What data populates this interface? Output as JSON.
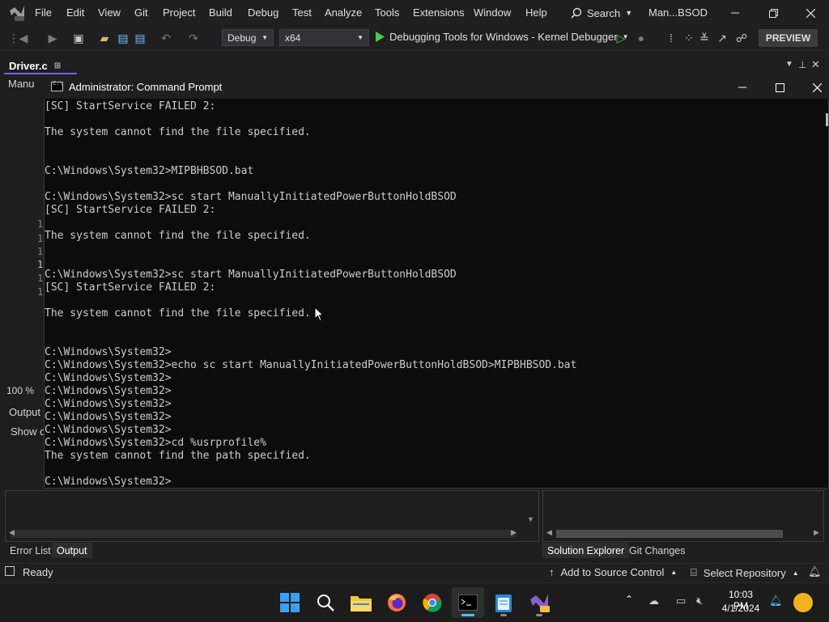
{
  "vs": {
    "menu": [
      "File",
      "Edit",
      "View",
      "Git",
      "Project",
      "Build",
      "Debug",
      "Test",
      "Analyze",
      "Tools",
      "Extensions",
      "Window",
      "Help"
    ],
    "search_label": "Search",
    "solution_name": "Man...BSOD",
    "config": "Debug",
    "platform": "x64",
    "debugger": "Debugging Tools for Windows - Kernel Debugger",
    "preview": "PREVIEW",
    "doc_tab": "Driver.c",
    "nav_label": "Manu",
    "line_numbers": [
      "1",
      "1",
      "1",
      "1",
      "1",
      "1"
    ],
    "zoom": "100 %",
    "output_title": "Output",
    "show_output_from": "Show o",
    "bottom_tabs_left": [
      "Error List",
      "Output"
    ],
    "bottom_tabs_right": [
      "Solution Explorer",
      "Git Changes"
    ],
    "status_ready": "Ready",
    "add_to_source_control": "Add to Source Control",
    "select_repository": "Select Repository",
    "accent_color": "#7160e8"
  },
  "cmd": {
    "title": "Administrator: Command Prompt",
    "lines": [
      "[SC] StartService FAILED 2:",
      "",
      "The system cannot find the file specified.",
      "",
      "",
      "C:\\Windows\\System32>MIPBHBSOD.bat",
      "",
      "C:\\Windows\\System32>sc start ManuallyInitiatedPowerButtonHoldBSOD",
      "[SC] StartService FAILED 2:",
      "",
      "The system cannot find the file specified.",
      "",
      "",
      "C:\\Windows\\System32>sc start ManuallyInitiatedPowerButtonHoldBSOD",
      "[SC] StartService FAILED 2:",
      "",
      "The system cannot find the file specified.",
      "",
      "",
      "C:\\Windows\\System32>",
      "C:\\Windows\\System32>echo sc start ManuallyInitiatedPowerButtonHoldBSOD>MIPBHBSOD.bat",
      "C:\\Windows\\System32>",
      "C:\\Windows\\System32>",
      "C:\\Windows\\System32>",
      "C:\\Windows\\System32>",
      "C:\\Windows\\System32>",
      "C:\\Windows\\System32>cd %usrprofile%",
      "The system cannot find the path specified.",
      "",
      "C:\\Windows\\System32>"
    ]
  },
  "taskbar": {
    "apps": [
      "start-button",
      "search-button",
      "file-explorer",
      "firefox",
      "chrome",
      "command-prompt",
      "notepad",
      "visual-studio"
    ],
    "time": "10:03 PM",
    "date": "4/1/2024"
  }
}
